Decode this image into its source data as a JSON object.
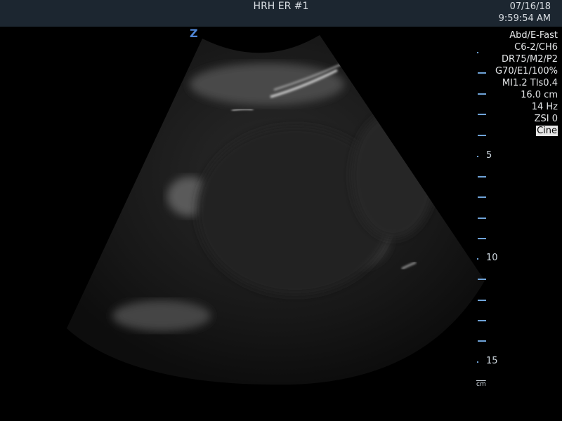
{
  "header": {
    "title": "HRH ER #1",
    "date": "07/16/18",
    "time": "9:59:54 AM"
  },
  "parameters": [
    "Abd/E-Fast",
    "C6-2/CH6",
    "DR75/M2/P2",
    "G70/E1/100%",
    "MI1.2  TIs0.4",
    "16.0 cm",
    "14 Hz",
    "ZSI 0"
  ],
  "mode_badge": "Cine",
  "orientation_marker": "Z",
  "depth_scale": {
    "labels": [
      "5",
      "10",
      "15"
    ],
    "unit": "cm"
  },
  "colors": {
    "topbar": "#1c2630",
    "scale": "#6fa3d8",
    "orientation": "#4f86d6"
  }
}
